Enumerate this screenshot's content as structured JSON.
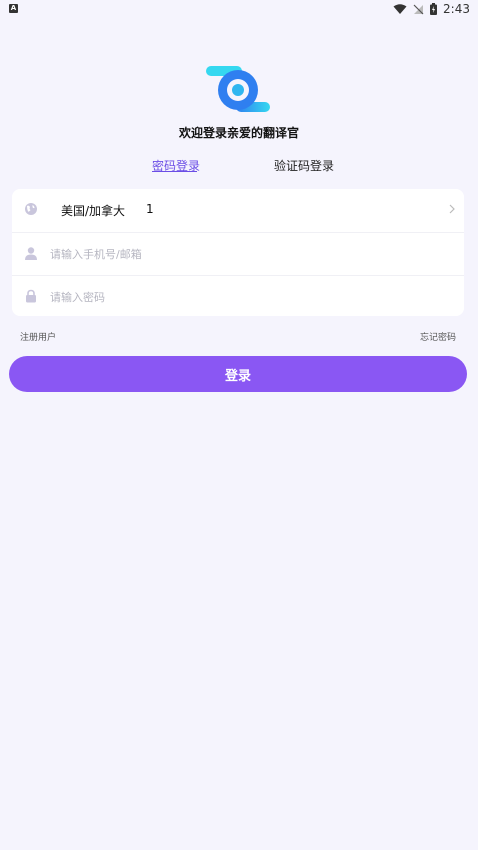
{
  "status_bar": {
    "left_icon": "A",
    "time": "2:43",
    "icons": [
      "wifi-icon",
      "signal-off-icon",
      "battery-charging-icon"
    ]
  },
  "logo": {
    "icon": "app-logo-icon",
    "colors": [
      "#2f7ff0",
      "#35d8f0"
    ]
  },
  "welcome": "欢迎登录亲爱的翻译官",
  "tabs": [
    {
      "label": "密码登录",
      "active": true
    },
    {
      "label": "验证码登录",
      "active": false
    }
  ],
  "form": {
    "country": "美国/加拿大",
    "country_code": "1",
    "account_placeholder": "请输入手机号/邮箱",
    "password_placeholder": "请输入密码"
  },
  "links": {
    "register": "注册用户",
    "forgot": "忘记密码"
  },
  "login_button": "登录",
  "colors": {
    "accent": "#8a57f3",
    "tab_active": "#6b4de6",
    "background": "#f5f4fd"
  }
}
